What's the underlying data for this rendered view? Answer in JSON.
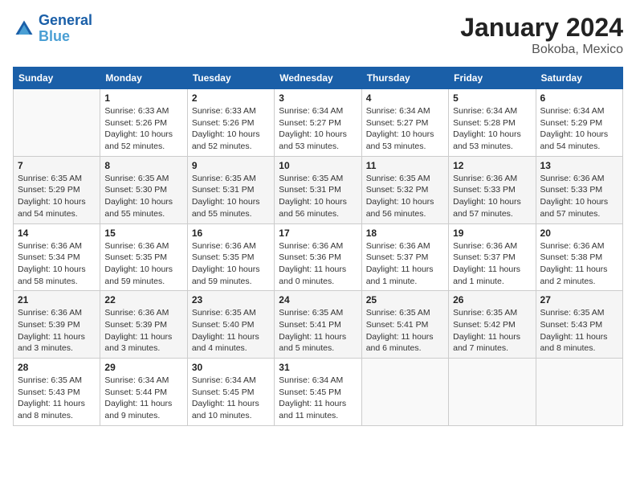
{
  "header": {
    "logo_line1": "General",
    "logo_line2": "Blue",
    "title": "January 2024",
    "subtitle": "Bokoba, Mexico"
  },
  "columns": [
    "Sunday",
    "Monday",
    "Tuesday",
    "Wednesday",
    "Thursday",
    "Friday",
    "Saturday"
  ],
  "weeks": [
    [
      {
        "num": "",
        "info": ""
      },
      {
        "num": "1",
        "info": "Sunrise: 6:33 AM\nSunset: 5:26 PM\nDaylight: 10 hours\nand 52 minutes."
      },
      {
        "num": "2",
        "info": "Sunrise: 6:33 AM\nSunset: 5:26 PM\nDaylight: 10 hours\nand 52 minutes."
      },
      {
        "num": "3",
        "info": "Sunrise: 6:34 AM\nSunset: 5:27 PM\nDaylight: 10 hours\nand 53 minutes."
      },
      {
        "num": "4",
        "info": "Sunrise: 6:34 AM\nSunset: 5:27 PM\nDaylight: 10 hours\nand 53 minutes."
      },
      {
        "num": "5",
        "info": "Sunrise: 6:34 AM\nSunset: 5:28 PM\nDaylight: 10 hours\nand 53 minutes."
      },
      {
        "num": "6",
        "info": "Sunrise: 6:34 AM\nSunset: 5:29 PM\nDaylight: 10 hours\nand 54 minutes."
      }
    ],
    [
      {
        "num": "7",
        "info": "Sunrise: 6:35 AM\nSunset: 5:29 PM\nDaylight: 10 hours\nand 54 minutes."
      },
      {
        "num": "8",
        "info": "Sunrise: 6:35 AM\nSunset: 5:30 PM\nDaylight: 10 hours\nand 55 minutes."
      },
      {
        "num": "9",
        "info": "Sunrise: 6:35 AM\nSunset: 5:31 PM\nDaylight: 10 hours\nand 55 minutes."
      },
      {
        "num": "10",
        "info": "Sunrise: 6:35 AM\nSunset: 5:31 PM\nDaylight: 10 hours\nand 56 minutes."
      },
      {
        "num": "11",
        "info": "Sunrise: 6:35 AM\nSunset: 5:32 PM\nDaylight: 10 hours\nand 56 minutes."
      },
      {
        "num": "12",
        "info": "Sunrise: 6:36 AM\nSunset: 5:33 PM\nDaylight: 10 hours\nand 57 minutes."
      },
      {
        "num": "13",
        "info": "Sunrise: 6:36 AM\nSunset: 5:33 PM\nDaylight: 10 hours\nand 57 minutes."
      }
    ],
    [
      {
        "num": "14",
        "info": "Sunrise: 6:36 AM\nSunset: 5:34 PM\nDaylight: 10 hours\nand 58 minutes."
      },
      {
        "num": "15",
        "info": "Sunrise: 6:36 AM\nSunset: 5:35 PM\nDaylight: 10 hours\nand 59 minutes."
      },
      {
        "num": "16",
        "info": "Sunrise: 6:36 AM\nSunset: 5:35 PM\nDaylight: 10 hours\nand 59 minutes."
      },
      {
        "num": "17",
        "info": "Sunrise: 6:36 AM\nSunset: 5:36 PM\nDaylight: 11 hours\nand 0 minutes."
      },
      {
        "num": "18",
        "info": "Sunrise: 6:36 AM\nSunset: 5:37 PM\nDaylight: 11 hours\nand 1 minute."
      },
      {
        "num": "19",
        "info": "Sunrise: 6:36 AM\nSunset: 5:37 PM\nDaylight: 11 hours\nand 1 minute."
      },
      {
        "num": "20",
        "info": "Sunrise: 6:36 AM\nSunset: 5:38 PM\nDaylight: 11 hours\nand 2 minutes."
      }
    ],
    [
      {
        "num": "21",
        "info": "Sunrise: 6:36 AM\nSunset: 5:39 PM\nDaylight: 11 hours\nand 3 minutes."
      },
      {
        "num": "22",
        "info": "Sunrise: 6:36 AM\nSunset: 5:39 PM\nDaylight: 11 hours\nand 3 minutes."
      },
      {
        "num": "23",
        "info": "Sunrise: 6:35 AM\nSunset: 5:40 PM\nDaylight: 11 hours\nand 4 minutes."
      },
      {
        "num": "24",
        "info": "Sunrise: 6:35 AM\nSunset: 5:41 PM\nDaylight: 11 hours\nand 5 minutes."
      },
      {
        "num": "25",
        "info": "Sunrise: 6:35 AM\nSunset: 5:41 PM\nDaylight: 11 hours\nand 6 minutes."
      },
      {
        "num": "26",
        "info": "Sunrise: 6:35 AM\nSunset: 5:42 PM\nDaylight: 11 hours\nand 7 minutes."
      },
      {
        "num": "27",
        "info": "Sunrise: 6:35 AM\nSunset: 5:43 PM\nDaylight: 11 hours\nand 8 minutes."
      }
    ],
    [
      {
        "num": "28",
        "info": "Sunrise: 6:35 AM\nSunset: 5:43 PM\nDaylight: 11 hours\nand 8 minutes."
      },
      {
        "num": "29",
        "info": "Sunrise: 6:34 AM\nSunset: 5:44 PM\nDaylight: 11 hours\nand 9 minutes."
      },
      {
        "num": "30",
        "info": "Sunrise: 6:34 AM\nSunset: 5:45 PM\nDaylight: 11 hours\nand 10 minutes."
      },
      {
        "num": "31",
        "info": "Sunrise: 6:34 AM\nSunset: 5:45 PM\nDaylight: 11 hours\nand 11 minutes."
      },
      {
        "num": "",
        "info": ""
      },
      {
        "num": "",
        "info": ""
      },
      {
        "num": "",
        "info": ""
      }
    ]
  ]
}
